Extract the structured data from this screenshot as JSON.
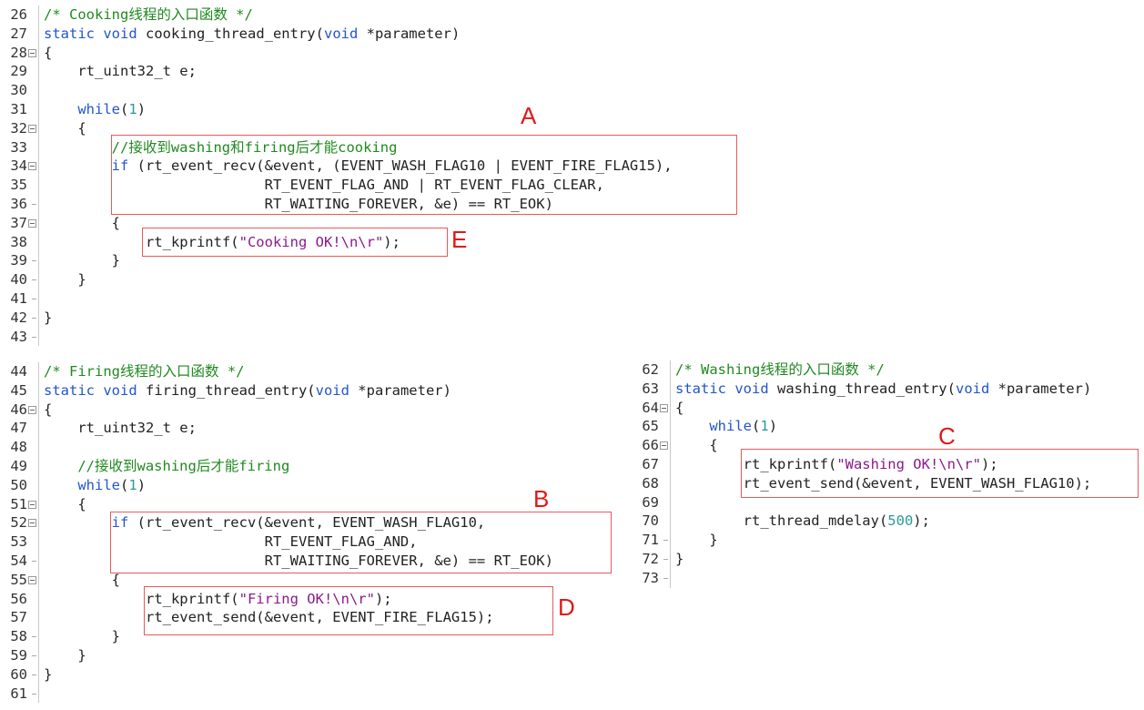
{
  "blocks": [
    {
      "id": "cooking",
      "lines": [
        {
          "n": "26",
          "fold": "none",
          "tokens": [
            {
              "t": "cm",
              "v": "/* Cooking线程的入口函数 */"
            }
          ]
        },
        {
          "n": "27",
          "fold": "none",
          "tokens": [
            {
              "t": "kw",
              "v": "static"
            },
            {
              "t": "p",
              "v": " "
            },
            {
              "t": "kw",
              "v": "void"
            },
            {
              "t": "p",
              "v": " cooking_thread_entry("
            },
            {
              "t": "kw",
              "v": "void"
            },
            {
              "t": "p",
              "v": " *parameter)"
            }
          ]
        },
        {
          "n": "28",
          "fold": "box",
          "tokens": [
            {
              "t": "p",
              "v": "{"
            }
          ]
        },
        {
          "n": "29",
          "fold": "bar",
          "tokens": [
            {
              "t": "p",
              "v": "    rt_uint32_t e;"
            }
          ]
        },
        {
          "n": "30",
          "fold": "bar",
          "tokens": []
        },
        {
          "n": "31",
          "fold": "bar",
          "tokens": [
            {
              "t": "p",
              "v": "    "
            },
            {
              "t": "kw",
              "v": "while"
            },
            {
              "t": "p",
              "v": "("
            },
            {
              "t": "num",
              "v": "1"
            },
            {
              "t": "p",
              "v": ")"
            }
          ]
        },
        {
          "n": "32",
          "fold": "box",
          "tokens": [
            {
              "t": "p",
              "v": "    {"
            }
          ]
        },
        {
          "n": "33",
          "fold": "bar",
          "tokens": [
            {
              "t": "p",
              "v": "        "
            },
            {
              "t": "cm",
              "v": "//接收到washing和firing后才能cooking"
            }
          ]
        },
        {
          "n": "34",
          "fold": "box",
          "tokens": [
            {
              "t": "p",
              "v": "        "
            },
            {
              "t": "kw",
              "v": "if"
            },
            {
              "t": "p",
              "v": " (rt_event_recv(&event, (EVENT_WASH_FLAG10 | EVENT_FIRE_FLAG15),"
            }
          ]
        },
        {
          "n": "35",
          "fold": "bar",
          "tokens": [
            {
              "t": "p",
              "v": "                          RT_EVENT_FLAG_AND | RT_EVENT_FLAG_CLEAR,"
            }
          ]
        },
        {
          "n": "36",
          "fold": "tick",
          "tokens": [
            {
              "t": "p",
              "v": "                          RT_WAITING_FOREVER, &e) == RT_EOK)"
            }
          ]
        },
        {
          "n": "37",
          "fold": "box",
          "tokens": [
            {
              "t": "p",
              "v": "        {"
            }
          ]
        },
        {
          "n": "38",
          "fold": "bar",
          "tokens": [
            {
              "t": "p",
              "v": "            rt_kprintf("
            },
            {
              "t": "str",
              "v": "\"Cooking OK!\\n\\r\""
            },
            {
              "t": "p",
              "v": ");"
            }
          ]
        },
        {
          "n": "39",
          "fold": "tick",
          "tokens": [
            {
              "t": "p",
              "v": "        }"
            }
          ]
        },
        {
          "n": "40",
          "fold": "tick",
          "tokens": [
            {
              "t": "p",
              "v": "    }"
            }
          ]
        },
        {
          "n": "41",
          "fold": "tick",
          "tokens": []
        },
        {
          "n": "42",
          "fold": "tick",
          "tokens": [
            {
              "t": "p",
              "v": "}"
            }
          ]
        },
        {
          "n": "43",
          "fold": "end",
          "tokens": []
        }
      ]
    },
    {
      "id": "firing",
      "lines": [
        {
          "n": "44",
          "fold": "none",
          "tokens": [
            {
              "t": "cm",
              "v": "/* Firing线程的入口函数 */"
            }
          ]
        },
        {
          "n": "45",
          "fold": "none",
          "tokens": [
            {
              "t": "kw",
              "v": "static"
            },
            {
              "t": "p",
              "v": " "
            },
            {
              "t": "kw",
              "v": "void"
            },
            {
              "t": "p",
              "v": " firing_thread_entry("
            },
            {
              "t": "kw",
              "v": "void"
            },
            {
              "t": "p",
              "v": " *parameter)"
            }
          ]
        },
        {
          "n": "46",
          "fold": "box",
          "tokens": [
            {
              "t": "p",
              "v": "{"
            }
          ]
        },
        {
          "n": "47",
          "fold": "bar",
          "tokens": [
            {
              "t": "p",
              "v": "    rt_uint32_t e;"
            }
          ]
        },
        {
          "n": "48",
          "fold": "bar",
          "tokens": []
        },
        {
          "n": "49",
          "fold": "bar",
          "tokens": [
            {
              "t": "p",
              "v": "    "
            },
            {
              "t": "cm",
              "v": "//接收到washing后才能firing"
            }
          ]
        },
        {
          "n": "50",
          "fold": "bar",
          "tokens": [
            {
              "t": "p",
              "v": "    "
            },
            {
              "t": "kw",
              "v": "while"
            },
            {
              "t": "p",
              "v": "("
            },
            {
              "t": "num",
              "v": "1"
            },
            {
              "t": "p",
              "v": ")"
            }
          ]
        },
        {
          "n": "51",
          "fold": "box",
          "tokens": [
            {
              "t": "p",
              "v": "    {"
            }
          ]
        },
        {
          "n": "52",
          "fold": "box",
          "tokens": [
            {
              "t": "p",
              "v": "        "
            },
            {
              "t": "kw",
              "v": "if"
            },
            {
              "t": "p",
              "v": " (rt_event_recv(&event, EVENT_WASH_FLAG10,"
            }
          ]
        },
        {
          "n": "53",
          "fold": "bar",
          "tokens": [
            {
              "t": "p",
              "v": "                          RT_EVENT_FLAG_AND,"
            }
          ]
        },
        {
          "n": "54",
          "fold": "tick",
          "tokens": [
            {
              "t": "p",
              "v": "                          RT_WAITING_FOREVER, &e) == RT_EOK)"
            }
          ]
        },
        {
          "n": "55",
          "fold": "box",
          "tokens": [
            {
              "t": "p",
              "v": "        {"
            }
          ]
        },
        {
          "n": "56",
          "fold": "bar",
          "tokens": [
            {
              "t": "p",
              "v": "            rt_kprintf("
            },
            {
              "t": "str",
              "v": "\"Firing OK!\\n\\r\""
            },
            {
              "t": "p",
              "v": ");"
            }
          ]
        },
        {
          "n": "57",
          "fold": "bar",
          "tokens": [
            {
              "t": "p",
              "v": "            rt_event_send(&event, EVENT_FIRE_FLAG15);"
            }
          ]
        },
        {
          "n": "58",
          "fold": "tick",
          "tokens": [
            {
              "t": "p",
              "v": "        }"
            }
          ]
        },
        {
          "n": "59",
          "fold": "tick",
          "tokens": [
            {
              "t": "p",
              "v": "    }"
            }
          ]
        },
        {
          "n": "60",
          "fold": "tick",
          "tokens": [
            {
              "t": "p",
              "v": "}"
            }
          ]
        },
        {
          "n": "61",
          "fold": "end",
          "tokens": []
        }
      ]
    },
    {
      "id": "washing",
      "lines": [
        {
          "n": "62",
          "fold": "none",
          "tokens": [
            {
              "t": "cm",
              "v": "/* Washing线程的入口函数 */"
            }
          ]
        },
        {
          "n": "63",
          "fold": "none",
          "tokens": [
            {
              "t": "kw",
              "v": "static"
            },
            {
              "t": "p",
              "v": " "
            },
            {
              "t": "kw",
              "v": "void"
            },
            {
              "t": "p",
              "v": " washing_thread_entry("
            },
            {
              "t": "kw",
              "v": "void"
            },
            {
              "t": "p",
              "v": " *parameter)"
            }
          ]
        },
        {
          "n": "64",
          "fold": "box",
          "tokens": [
            {
              "t": "p",
              "v": "{"
            }
          ]
        },
        {
          "n": "65",
          "fold": "bar",
          "tokens": [
            {
              "t": "p",
              "v": "    "
            },
            {
              "t": "kw",
              "v": "while"
            },
            {
              "t": "p",
              "v": "("
            },
            {
              "t": "num",
              "v": "1"
            },
            {
              "t": "p",
              "v": ")"
            }
          ]
        },
        {
          "n": "66",
          "fold": "box",
          "tokens": [
            {
              "t": "p",
              "v": "    {"
            }
          ]
        },
        {
          "n": "67",
          "fold": "bar",
          "tokens": [
            {
              "t": "p",
              "v": "        rt_kprintf("
            },
            {
              "t": "str",
              "v": "\"Washing OK!\\n\\r\""
            },
            {
              "t": "p",
              "v": ");"
            }
          ]
        },
        {
          "n": "68",
          "fold": "bar",
          "tokens": [
            {
              "t": "p",
              "v": "        rt_event_send(&event, EVENT_WASH_FLAG10);"
            }
          ]
        },
        {
          "n": "69",
          "fold": "bar",
          "tokens": []
        },
        {
          "n": "70",
          "fold": "bar",
          "tokens": [
            {
              "t": "p",
              "v": "        rt_thread_mdelay("
            },
            {
              "t": "num",
              "v": "500"
            },
            {
              "t": "p",
              "v": ");"
            }
          ]
        },
        {
          "n": "71",
          "fold": "tick",
          "tokens": [
            {
              "t": "p",
              "v": "    }"
            }
          ]
        },
        {
          "n": "72",
          "fold": "tick",
          "tokens": [
            {
              "t": "p",
              "v": "}"
            }
          ]
        },
        {
          "n": "73",
          "fold": "end",
          "tokens": []
        }
      ]
    }
  ],
  "annotations": {
    "A": "A",
    "B": "B",
    "C": "C",
    "D": "D",
    "E": "E"
  },
  "colors": {
    "keyword": "#2255cc",
    "comment": "#208a20",
    "string": "#8a1a8a",
    "number": "#2a9a9a",
    "highlight_box": "#e85a5a",
    "annotation_letter": "#e01818"
  }
}
